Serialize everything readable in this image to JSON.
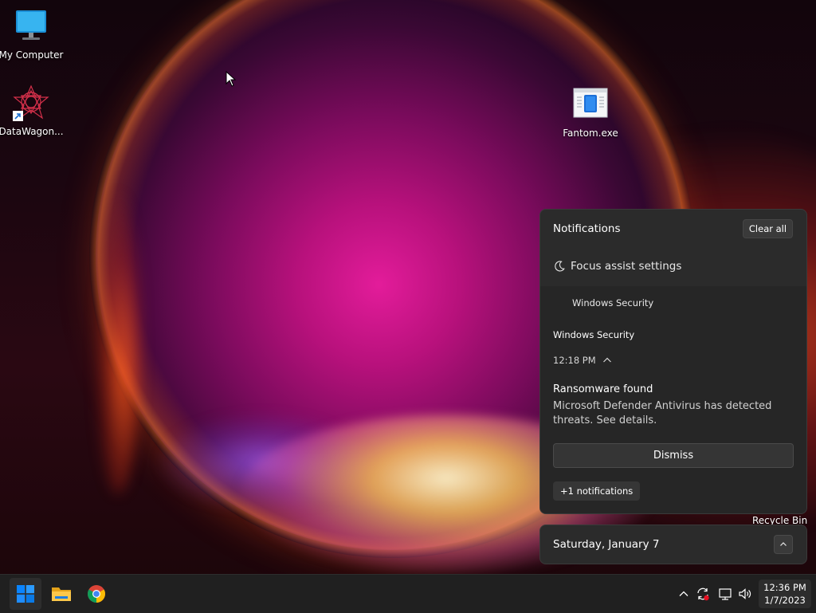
{
  "desktop": {
    "icons": [
      {
        "label": "My Computer",
        "icon": "monitor-icon"
      },
      {
        "label": "DataWagon...",
        "icon": "datawagon-app-icon"
      },
      {
        "label": "Fantom.exe",
        "icon": "exe-file-icon"
      }
    ],
    "recycle_bin_label": "Recycle Bin"
  },
  "notifications": {
    "title": "Notifications",
    "clear_all_label": "Clear all",
    "focus_assist_label": "Focus assist settings",
    "app_header": "Windows Security",
    "item": {
      "app_name": "Windows Security",
      "time": "12:18 PM",
      "title": "Ransomware found",
      "body": "Microsoft Defender Antivirus has detected threats. See details.",
      "dismiss_label": "Dismiss"
    },
    "more_label": "+1 notifications"
  },
  "calendar": {
    "date_label": "Saturday, January 7"
  },
  "taskbar": {
    "pinned": [
      "start-icon",
      "file-explorer-icon",
      "chrome-icon"
    ],
    "tray": [
      "chevron-up-icon",
      "sync-icon",
      "network-icon",
      "volume-icon"
    ],
    "clock": {
      "time": "12:36 PM",
      "date": "1/7/2023"
    }
  },
  "colors": {
    "panel_bg": "#2b2b2b",
    "taskbar_bg": "#202020",
    "windows_blue": "#0a84ff"
  }
}
